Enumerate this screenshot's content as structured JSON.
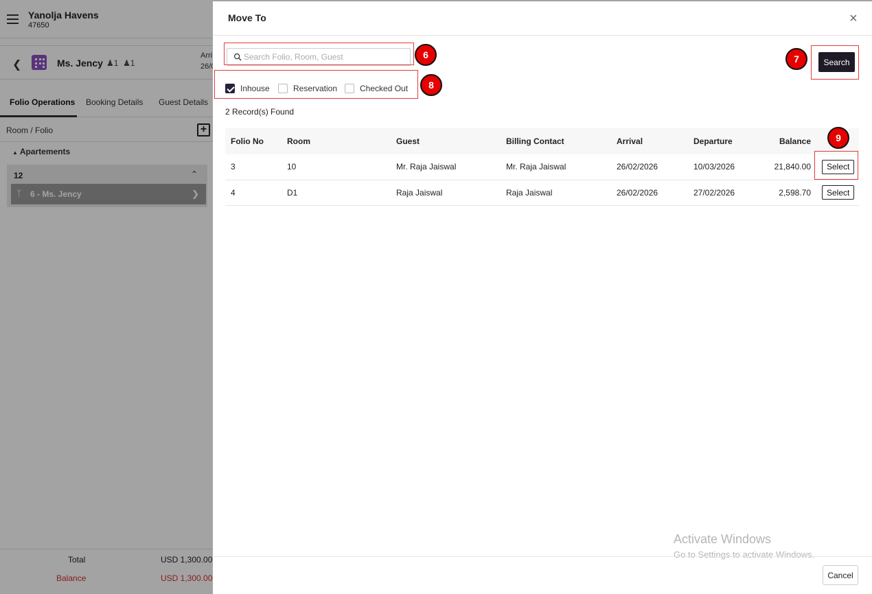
{
  "app": {
    "name": "Yanolja Havens",
    "code": "47650"
  },
  "guest_bar": {
    "name": "Ms. Jency",
    "adults": "1",
    "children": "1",
    "arrival_label": "Arri",
    "arrival_value": "26/0"
  },
  "tabs": [
    {
      "label": "Folio Operations",
      "active": true
    },
    {
      "label": "Booking Details",
      "active": false
    },
    {
      "label": "Guest Details",
      "active": false
    }
  ],
  "sidebar": {
    "room_folio_label": "Room / Folio",
    "group_label": "Apartements",
    "room_number": "12",
    "folio_item": "6 - Ms. Jency"
  },
  "totals": {
    "total_label": "Total",
    "total_value": "USD 1,300.00",
    "balance_label": "Balance",
    "balance_value": "USD 1,300.00"
  },
  "modal": {
    "title": "Move To",
    "close_glyph": "×",
    "search_placeholder": "Search Folio, Room, Guest",
    "search_value": "",
    "search_button": "Search",
    "filters": [
      {
        "label": "Inhouse",
        "checked": true
      },
      {
        "label": "Reservation",
        "checked": false
      },
      {
        "label": "Checked Out",
        "checked": false
      }
    ],
    "records_found": "2 Record(s) Found",
    "columns": [
      "Folio No",
      "Room",
      "Guest",
      "Billing Contact",
      "Arrival",
      "Departure",
      "Balance"
    ],
    "rows": [
      {
        "folio_no": "3",
        "room": "10",
        "guest": "Mr. Raja Jaiswal",
        "billing_contact": "Mr. Raja Jaiswal",
        "arrival": "26/02/2026",
        "departure": "10/03/2026",
        "balance": "21,840.00",
        "action": "Select"
      },
      {
        "folio_no": "4",
        "room": "D1",
        "guest": "Raja Jaiswal",
        "billing_contact": "Raja Jaiswal",
        "arrival": "26/02/2026",
        "departure": "27/02/2026",
        "balance": "2,598.70",
        "action": "Select"
      }
    ],
    "cancel_button": "Cancel"
  },
  "watermark": {
    "line1": "Activate Windows",
    "line2": "Go to Settings to activate Windows."
  },
  "annotations": [
    "6",
    "7",
    "8",
    "9"
  ],
  "colors": {
    "accent_dark": "#1e1b26",
    "annotation_red": "#e60000",
    "balance_red": "#d32f2f",
    "building_purple": "#8a4fc1"
  }
}
